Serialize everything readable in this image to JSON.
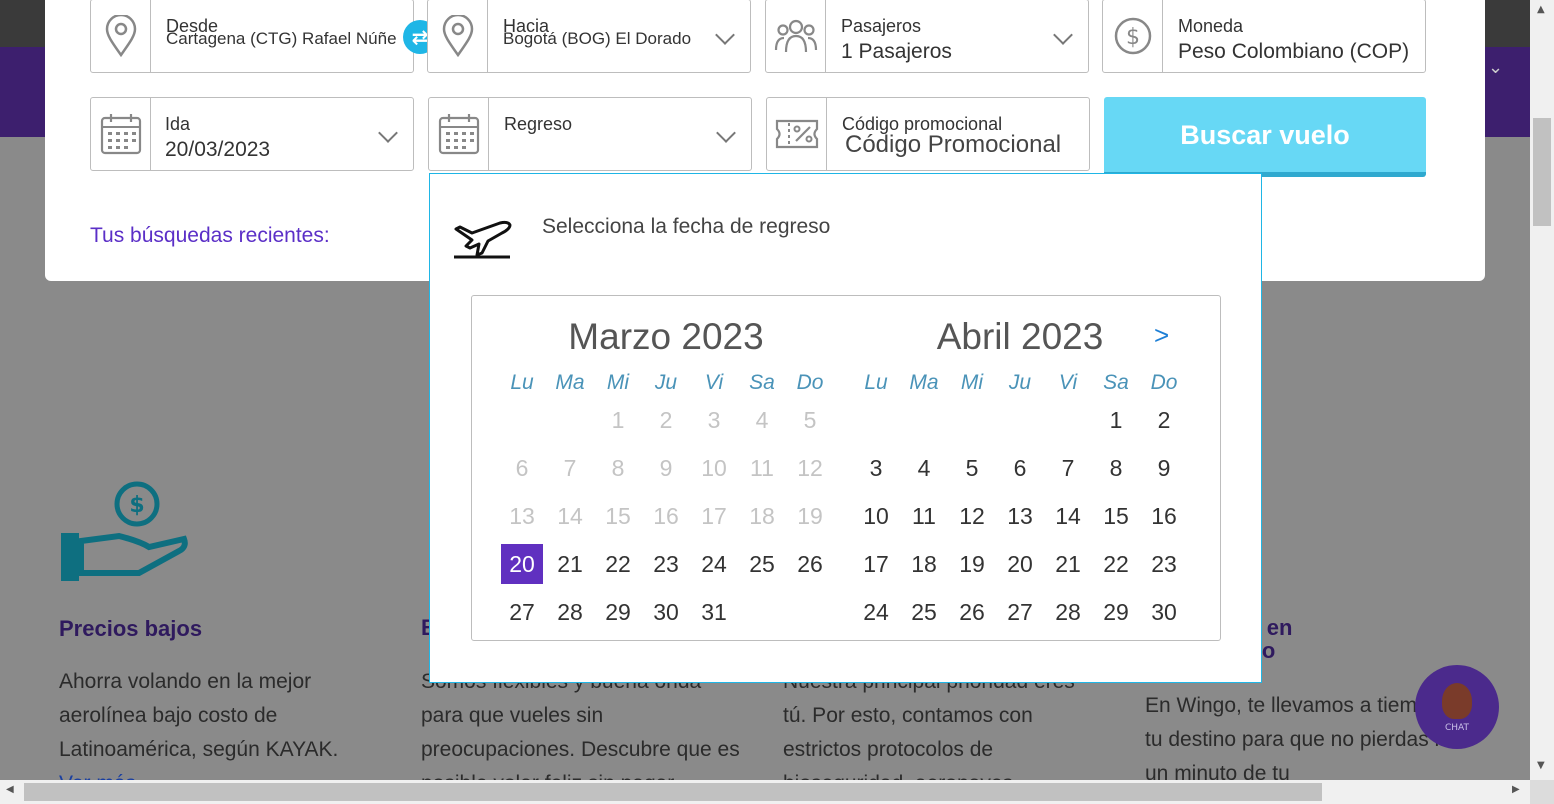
{
  "colors": {
    "accent": "#1fb6e6",
    "brand_purple": "#6030c0",
    "button": "#67d8f5"
  },
  "search": {
    "from": {
      "label": "Desde",
      "value": "Cartagena (CTG) Rafael Núñez"
    },
    "to": {
      "label": "Hacia",
      "value": "Bogotá (BOG) El Dorado"
    },
    "passengers": {
      "label": "Pasajeros",
      "value": "1 Pasajeros"
    },
    "currency": {
      "label": "Moneda",
      "value": "Peso Colombiano (COP)"
    },
    "depart": {
      "label": "Ida",
      "value": "20/03/2023"
    },
    "return": {
      "label": "Regreso",
      "value": ""
    },
    "promo": {
      "label": "Código promocional",
      "placeholder": "Código Promocional"
    },
    "swap_icon": "⇄",
    "button_label": "Buscar vuelo",
    "recent_label": "Tus búsquedas recientes:"
  },
  "datepicker": {
    "title": "Selecciona la fecha de regreso",
    "next_label": ">",
    "weekdays": [
      "Lu",
      "Ma",
      "Mi",
      "Ju",
      "Vi",
      "Sa",
      "Do"
    ],
    "months": [
      {
        "title": "Marzo 2023",
        "selected": 20,
        "weeks": [
          [
            "",
            "",
            "1",
            "2",
            "3",
            "4",
            "5"
          ],
          [
            "6",
            "7",
            "8",
            "9",
            "10",
            "11",
            "12"
          ],
          [
            "13",
            "14",
            "15",
            "16",
            "17",
            "18",
            "19"
          ],
          [
            "20",
            "21",
            "22",
            "23",
            "24",
            "25",
            "26"
          ],
          [
            "27",
            "28",
            "29",
            "30",
            "31",
            "",
            ""
          ]
        ],
        "disabled_until": 19
      },
      {
        "title": "Abril 2023",
        "weeks": [
          [
            "",
            "",
            "",
            "",
            "",
            "1",
            "2"
          ],
          [
            "3",
            "4",
            "5",
            "6",
            "7",
            "8",
            "9"
          ],
          [
            "10",
            "11",
            "12",
            "13",
            "14",
            "15",
            "16"
          ],
          [
            "17",
            "18",
            "19",
            "20",
            "21",
            "22",
            "23"
          ],
          [
            "24",
            "25",
            "26",
            "27",
            "28",
            "29",
            "30"
          ]
        ]
      }
    ]
  },
  "features": [
    {
      "title": "Precios bajos",
      "text": "Ahorra volando en la mejor aerolínea bajo costo de Latinoamérica, según KAYAK.",
      "link": "Ver más"
    },
    {
      "title": "B",
      "text": "Somos flexibles y buena onda para que vueles sin preocupaciones. Descubre que es posible volar feliz sin pagar"
    },
    {
      "title": "",
      "text": "Nuestra principal prioridad eres tú. Por esto, contamos con estrictos protocolos de bioseguridad, aeronaves"
    },
    {
      "title": "ad en\nngo",
      "text": "En Wingo, te llevamos a tiempo a tu destino para que no pierdas ni un minuto de tu"
    }
  ],
  "chat": {
    "label": "CHAT"
  }
}
